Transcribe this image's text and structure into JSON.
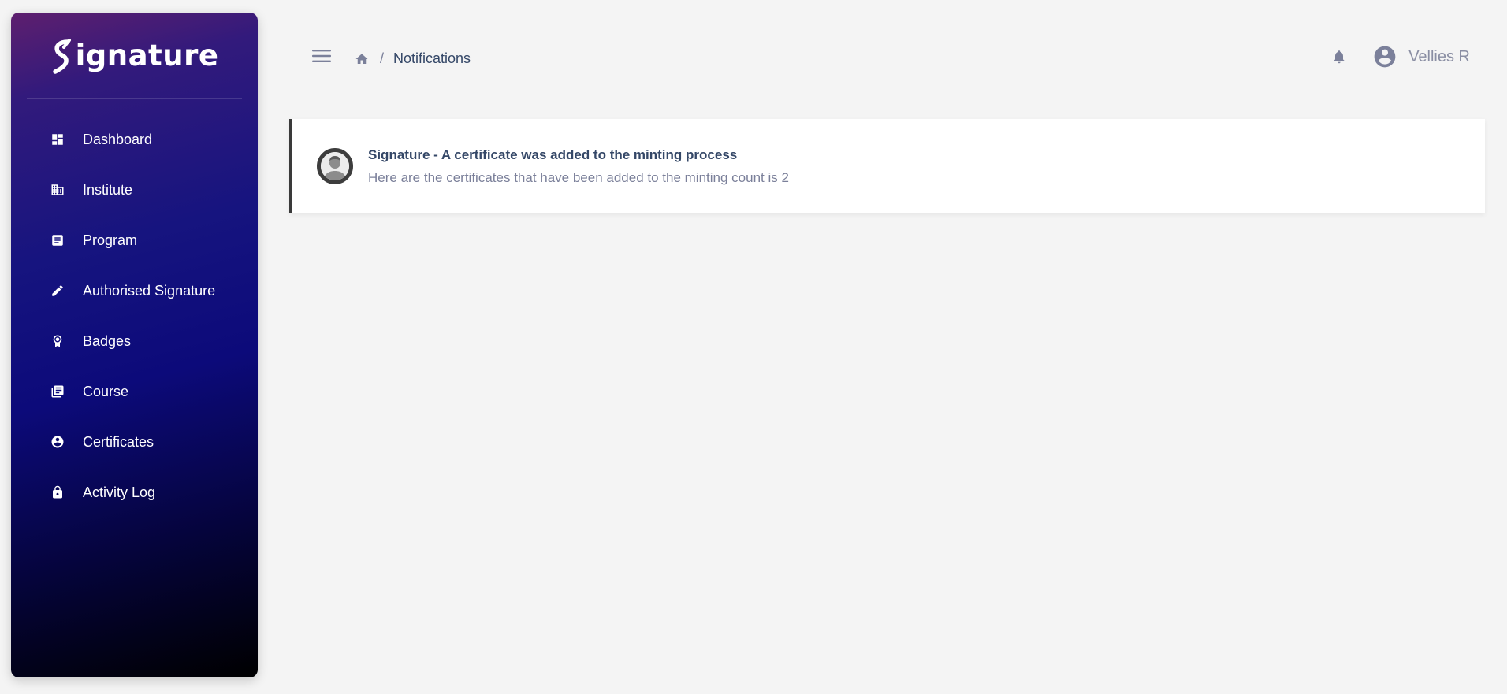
{
  "brand": {
    "name": "ignature",
    "logo_letter": "S"
  },
  "sidebar": {
    "items": [
      {
        "label": "Dashboard",
        "icon": "dashboard-icon"
      },
      {
        "label": "Institute",
        "icon": "building-icon"
      },
      {
        "label": "Program",
        "icon": "document-icon"
      },
      {
        "label": "Authorised Signature",
        "icon": "pencil-icon"
      },
      {
        "label": "Badges",
        "icon": "badge-icon"
      },
      {
        "label": "Course",
        "icon": "library-books-icon"
      },
      {
        "label": "Certificates",
        "icon": "account-circle-icon"
      },
      {
        "label": "Activity Log",
        "icon": "lock-icon"
      }
    ]
  },
  "header": {
    "menu_icon": "hamburger-menu-icon",
    "breadcrumb": {
      "home_icon": "home-icon",
      "separator": "/",
      "current": "Notifications"
    },
    "bell_icon": "bell-icon",
    "user": {
      "icon": "account-circle-icon",
      "name": "Vellies R"
    }
  },
  "notifications": [
    {
      "title": "Signature - A certificate was added to the minting process",
      "body": "Here are the certificates that have been added to the minting count is 2",
      "avatar_icon": "user-avatar-icon"
    }
  ],
  "colors": {
    "sidebar_gradient_top": "#5e1f6e",
    "sidebar_gradient_mid": "#0c0a7a",
    "sidebar_gradient_bottom": "#000000",
    "text_dark": "#344767",
    "text_muted": "#7b809a",
    "background": "#f4f4f4"
  }
}
